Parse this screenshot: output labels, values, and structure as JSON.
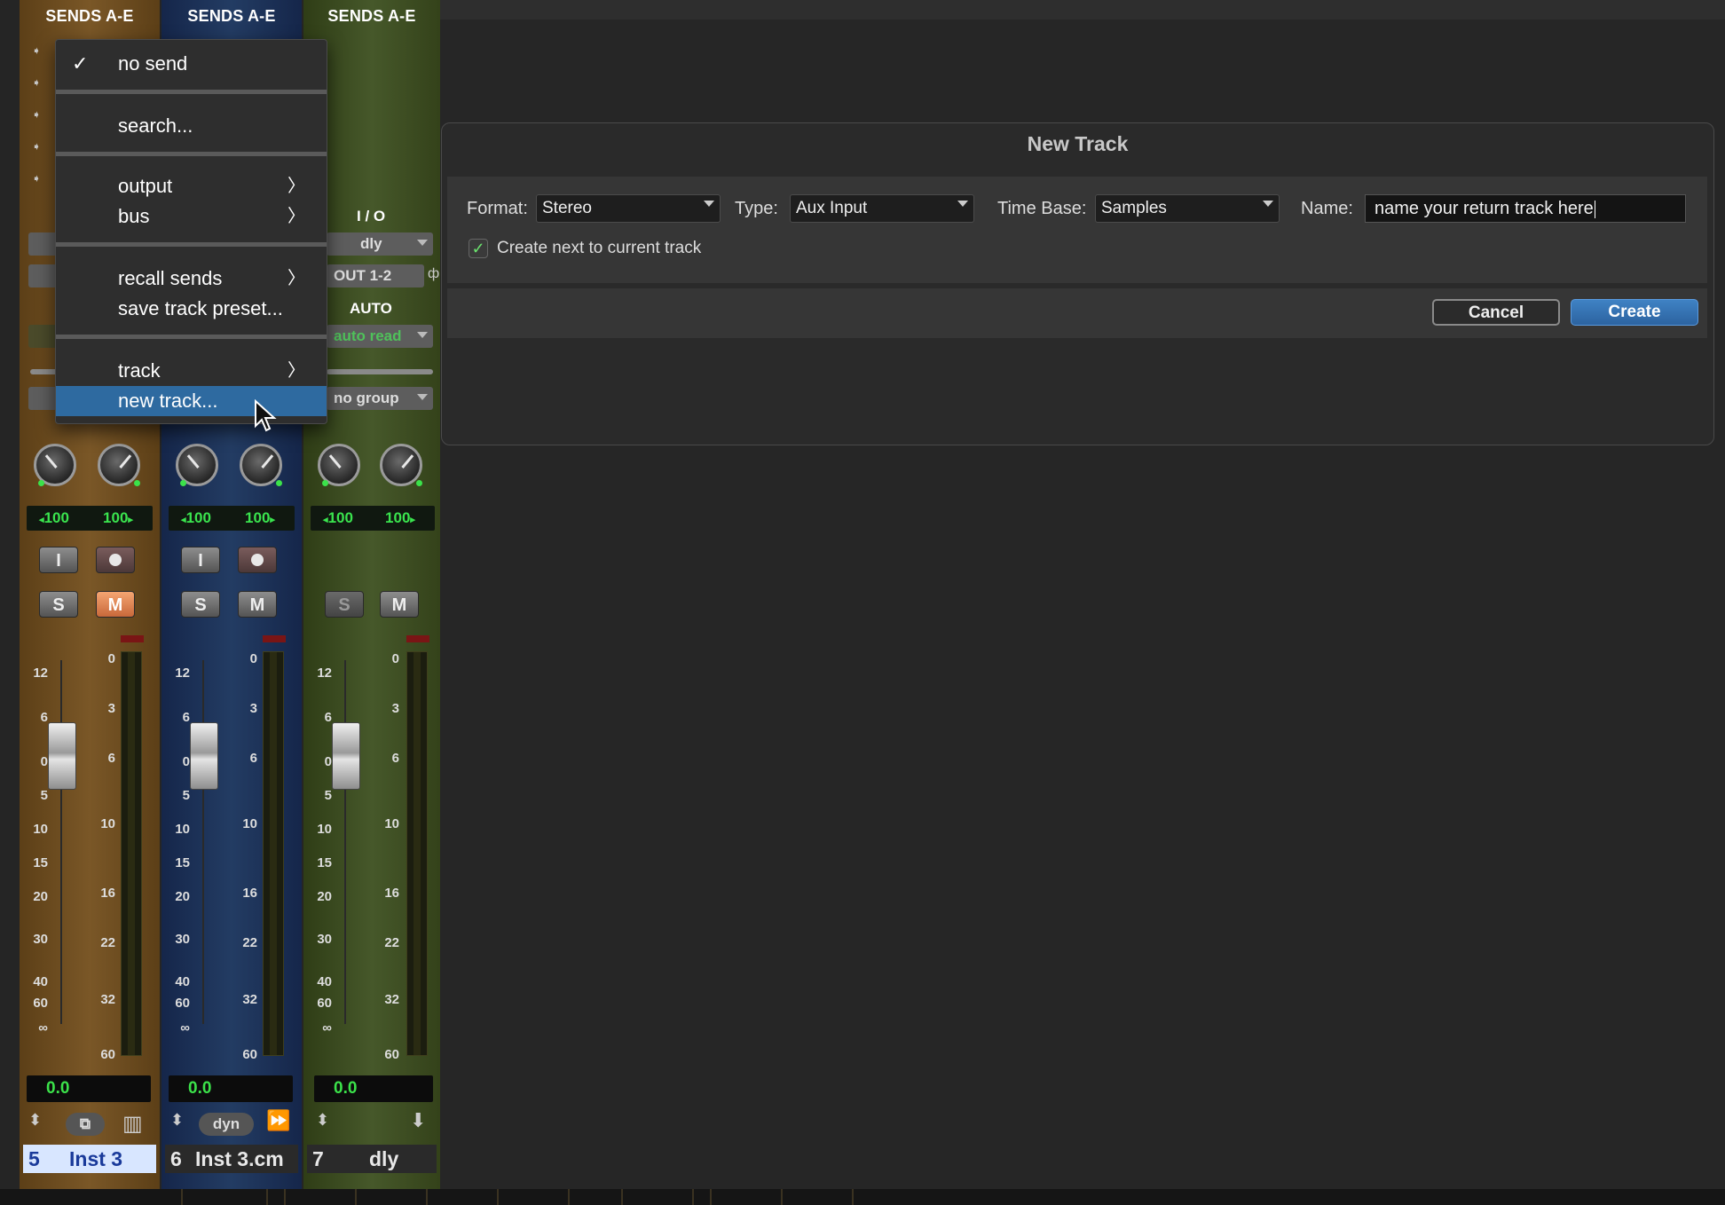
{
  "mixer": {
    "strips": [
      {
        "header": "SENDS A-E",
        "pan_left": "100",
        "pan_right": "100",
        "volume": "0.0",
        "track_number": "5",
        "track_name": "Inst 3",
        "input_btn": "I",
        "solo": "S",
        "mute": "M",
        "colors": {
          "bg": "#6a4a1e",
          "name_bg": "#d8e6ff",
          "name_fg": "#1a3a9a"
        }
      },
      {
        "header": "SENDS A-E",
        "pan_left": "100",
        "pan_right": "100",
        "volume": "0.0",
        "track_number": "6",
        "track_name": "Inst 3.cm",
        "input_btn": "I",
        "solo": "S",
        "mute": "M",
        "automation_btn": "dyn",
        "colors": {
          "bg": "#1e3455",
          "name_bg": "#2a2a2a",
          "name_fg": "#e8e8e8"
        }
      },
      {
        "header": "SENDS A-E",
        "io_label": "I / O",
        "input": "dly",
        "output": "OUT 1-2",
        "auto_label": "AUTO",
        "auto_mode": "auto read",
        "group": "no group",
        "pan_left": "100",
        "pan_right": "100",
        "volume": "0.0",
        "track_number": "7",
        "track_name": "dly",
        "solo": "S",
        "mute": "M",
        "colors": {
          "bg": "#3d4d1c",
          "name_bg": "#2a2a2a",
          "name_fg": "#e8e8e8"
        }
      }
    ],
    "fader_scale": [
      "12",
      "6",
      "0",
      "5",
      "10",
      "15",
      "20",
      "30",
      "40",
      "60",
      "∞"
    ],
    "meter_scale": [
      "0",
      "3",
      "6",
      "10",
      "16",
      "22",
      "32",
      "60"
    ]
  },
  "send_menu": {
    "items": [
      {
        "label": "no send",
        "checked": true
      },
      {
        "label": "search..."
      },
      {
        "label": "output",
        "submenu": true
      },
      {
        "label": "bus",
        "submenu": true
      },
      {
        "label": "recall sends",
        "submenu": true
      },
      {
        "label": "save track preset..."
      },
      {
        "label": "track",
        "submenu": true
      },
      {
        "label": "new track...",
        "highlighted": true
      }
    ],
    "check_glyph": "✓",
    "chevron_glyph": "〉"
  },
  "new_track_dialog": {
    "title": "New Track",
    "format_label": "Format:",
    "format_value": "Stereo",
    "type_label": "Type:",
    "type_value": "Aux Input",
    "timebase_label": "Time Base:",
    "timebase_value": "Samples",
    "name_label": "Name:",
    "name_value": "name your return track here",
    "create_next_label": "Create next to current track",
    "create_next_checked": true,
    "cancel_label": "Cancel",
    "create_label": "Create"
  },
  "colors": {
    "accent": "#2e6aa0",
    "meter_green": "#3be24a",
    "mute_orange": "#e08a55"
  },
  "icons": {
    "cursor": "arrow-cursor-icon"
  }
}
